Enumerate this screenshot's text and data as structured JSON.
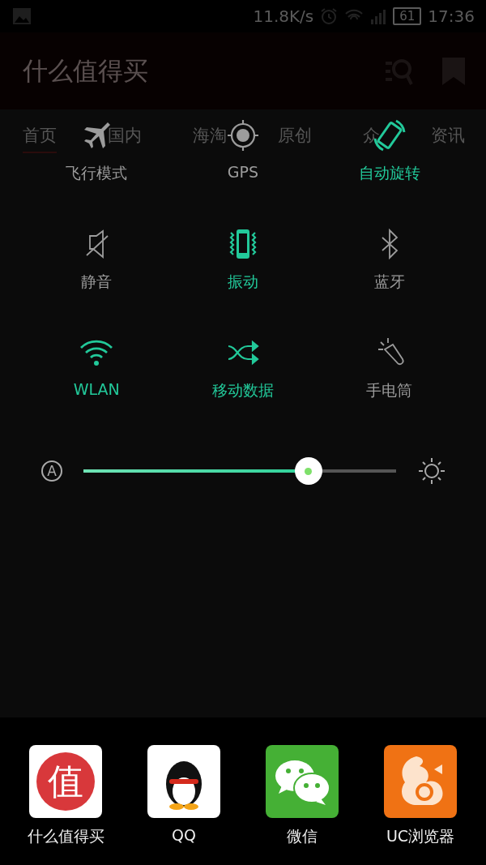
{
  "status_bar": {
    "net_speed": "11.8K/s",
    "battery": "61",
    "time": "17:36"
  },
  "app_header": {
    "title": "什么值得买"
  },
  "app_tabs": [
    {
      "label": "首页",
      "selected": true
    },
    {
      "label": "国内",
      "selected": false
    },
    {
      "label": "海淘",
      "selected": false
    },
    {
      "label": "原创",
      "selected": false
    },
    {
      "label": "众",
      "selected": false
    },
    {
      "label": "资讯",
      "selected": false
    }
  ],
  "quick_settings": [
    {
      "kind": "airplane",
      "label": "飞行模式",
      "on": false
    },
    {
      "kind": "gps",
      "label": "GPS",
      "on": false
    },
    {
      "kind": "rotate",
      "label": "自动旋转",
      "on": true
    },
    {
      "kind": "mute",
      "label": "静音",
      "on": false
    },
    {
      "kind": "vibrate",
      "label": "振动",
      "on": true
    },
    {
      "kind": "bluetooth",
      "label": "蓝牙",
      "on": false
    },
    {
      "kind": "wifi",
      "label": "WLAN",
      "on": true
    },
    {
      "kind": "data",
      "label": "移动数据",
      "on": true
    },
    {
      "kind": "flashlight",
      "label": "手电筒",
      "on": false
    }
  ],
  "brightness": {
    "auto_label": "A",
    "level": 0.72
  },
  "dock": [
    {
      "kind": "zhi",
      "label": "什么值得买",
      "glyph": "值"
    },
    {
      "kind": "penguin",
      "label": "QQ"
    },
    {
      "kind": "chat",
      "label": "微信"
    },
    {
      "kind": "squirrel",
      "label": "UC浏览器"
    }
  ]
}
